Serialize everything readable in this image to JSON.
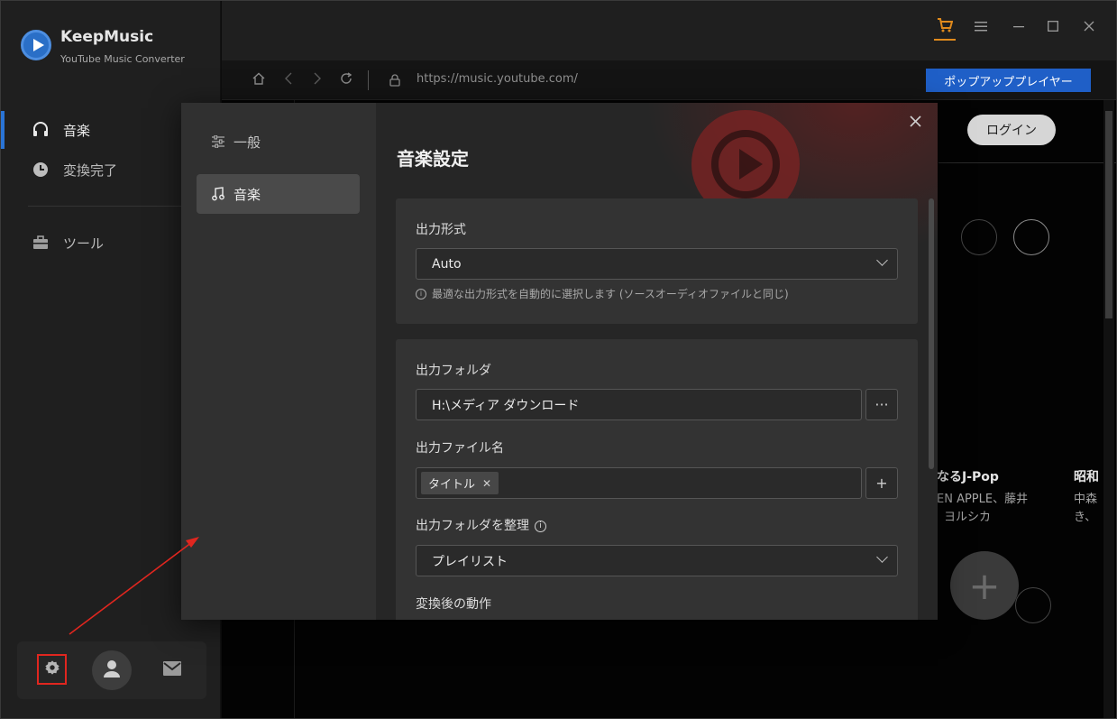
{
  "app": {
    "name": "KeepMusic",
    "subtitle": "YouTube Music Converter"
  },
  "sidebar": {
    "items": [
      {
        "label": "音楽",
        "icon": "headphones-icon",
        "active": true
      },
      {
        "label": "変換完了",
        "icon": "clock-icon",
        "active": false
      },
      {
        "label": "ツール",
        "icon": "toolbox-icon",
        "active": false
      }
    ],
    "bottom": [
      "gear-icon",
      "user-avatar-icon",
      "mail-icon"
    ]
  },
  "browser": {
    "url": "https://music.youtube.com/",
    "popup_player_label": "ポップアッププレイヤー",
    "login_label": "ログイン"
  },
  "webview": {
    "card1_title": "なるJ-Pop",
    "card1_line1": "EN APPLE、藤井",
    "card1_line2": "ヨルシカ",
    "card2_title": "昭和",
    "card2_line1": "中森",
    "card2_line2": "き、"
  },
  "dialog": {
    "nav": [
      {
        "label": "一般",
        "icon": "sliders-icon",
        "active": false
      },
      {
        "label": "音楽",
        "icon": "music-note-icon",
        "active": true
      }
    ],
    "title": "音楽設定",
    "output_format_label": "出力形式",
    "output_format_value": "Auto",
    "output_format_hint": "最適な出力形式を自動的に選択します (ソースオーディオファイルと同じ)",
    "output_folder_label": "出力フォルダ",
    "output_folder_value": "H:\\メディア ダウンロード",
    "browse_label": "···",
    "output_filename_label": "出力ファイル名",
    "filename_tag": "タイトル",
    "add_label": "+",
    "organize_label": "出力フォルダを整理",
    "organize_value": "プレイリスト",
    "after_convert_label": "変換後の動作"
  },
  "colors": {
    "accent": "#2a74d6",
    "popup_button": "#1f5fc7",
    "annotation": "#e0261f",
    "cart": "#e08a1c"
  }
}
